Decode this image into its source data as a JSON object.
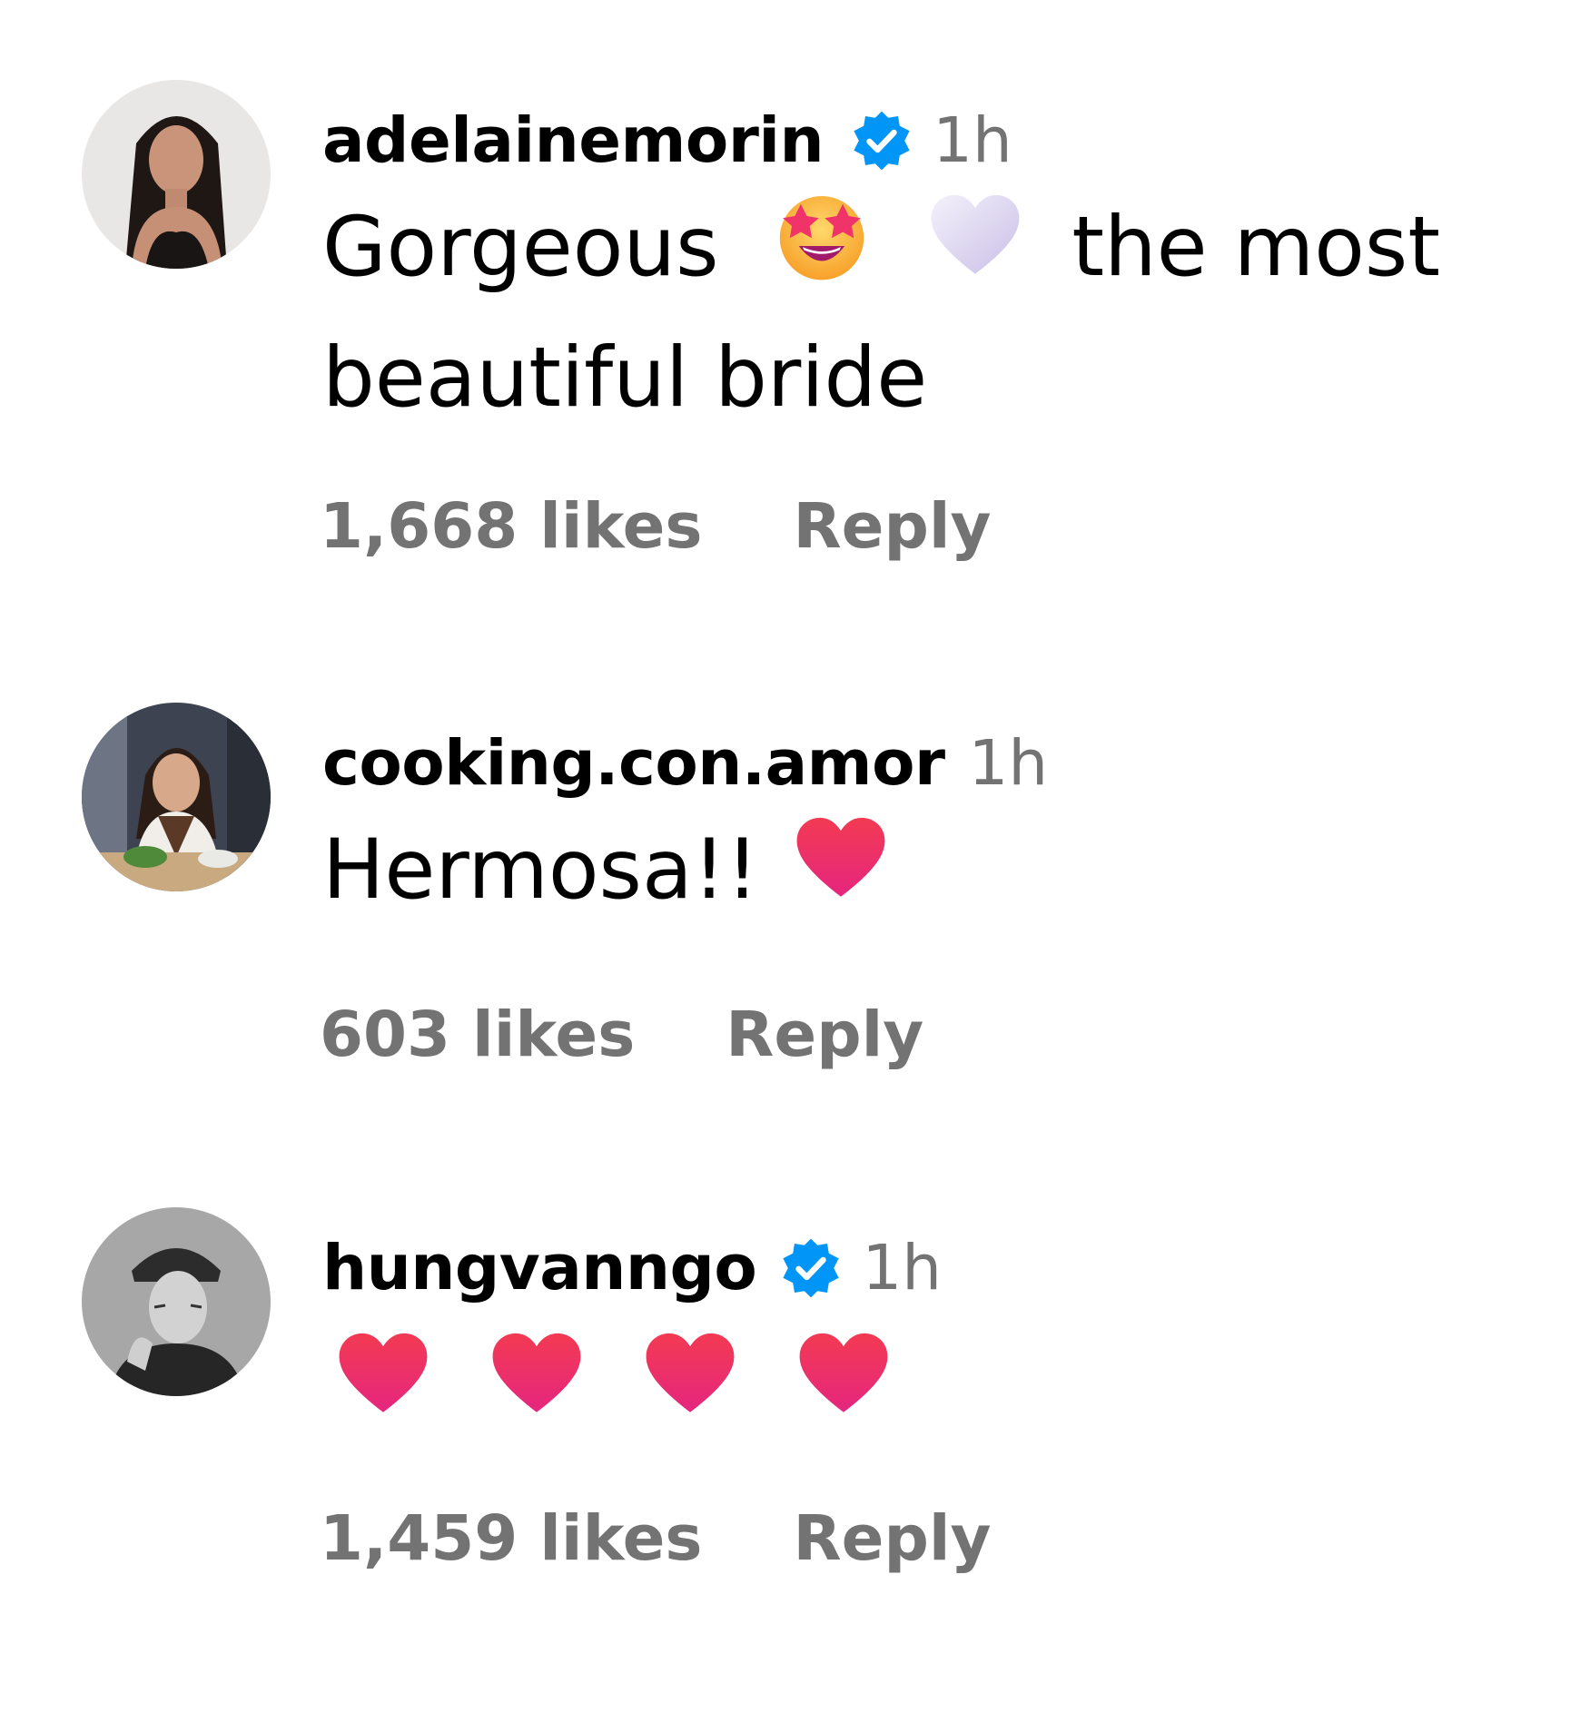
{
  "colors": {
    "text": "#000000",
    "muted": "#737373",
    "verified": "#0095f6"
  },
  "comments": [
    {
      "username": "adelainemorin",
      "verified": true,
      "time": "1h",
      "text_before": "Gorgeous",
      "emojis_inline": [
        "star-struck-emoji",
        "white-heart-emoji"
      ],
      "text_after": " the most beautiful bride",
      "likes": "1,668 likes",
      "reply": "Reply"
    },
    {
      "username": "cooking.con.amor",
      "verified": false,
      "time": "1h",
      "text_before": "Hermosa!!",
      "emojis_inline": [
        "red-heart-emoji"
      ],
      "likes": "603 likes",
      "reply": "Reply"
    },
    {
      "username": "hungvanngo",
      "verified": true,
      "time": "1h",
      "emojis_inline": [
        "red-heart-emoji",
        "red-heart-emoji",
        "red-heart-emoji",
        "red-heart-emoji"
      ],
      "likes": "1,459 likes",
      "reply": "Reply"
    }
  ]
}
